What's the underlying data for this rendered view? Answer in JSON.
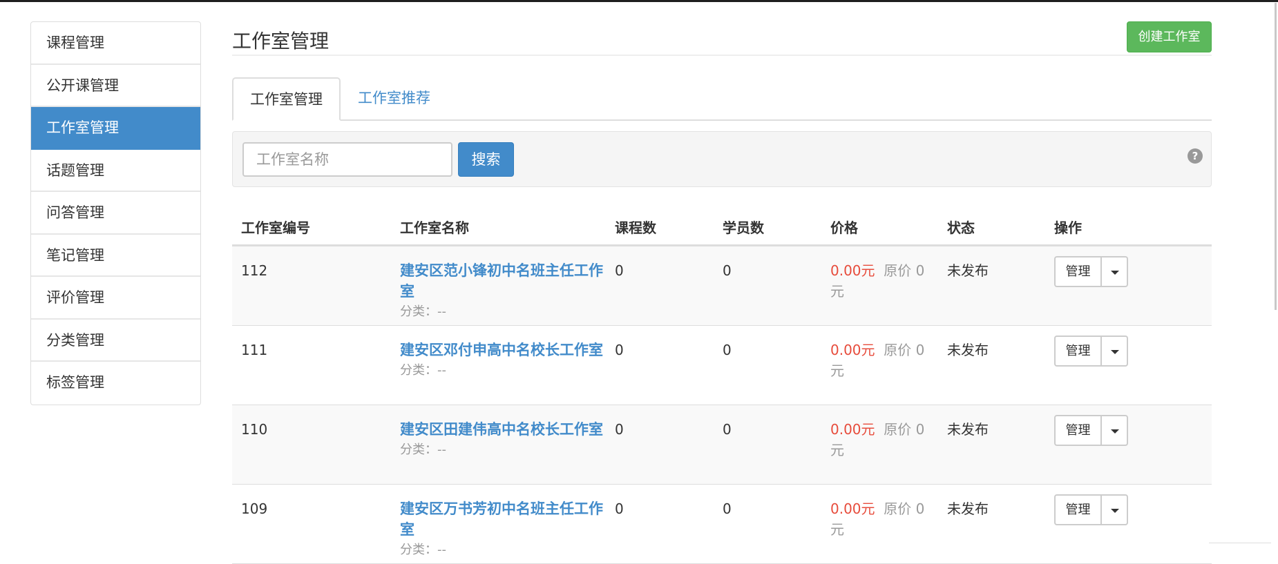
{
  "sidebar": {
    "items": [
      {
        "label": "课程管理"
      },
      {
        "label": "公开课管理"
      },
      {
        "label": "工作室管理",
        "active": true
      },
      {
        "label": "话题管理"
      },
      {
        "label": "问答管理"
      },
      {
        "label": "笔记管理"
      },
      {
        "label": "评价管理"
      },
      {
        "label": "分类管理"
      },
      {
        "label": "标签管理"
      }
    ]
  },
  "header": {
    "title": "工作室管理",
    "create_button": "创建工作室"
  },
  "tabs": [
    {
      "label": "工作室管理",
      "active": true
    },
    {
      "label": "工作室推荐"
    }
  ],
  "search": {
    "placeholder": "工作室名称",
    "button": "搜索",
    "help_icon": "question-circle-icon"
  },
  "table": {
    "columns": [
      "工作室编号",
      "工作室名称",
      "课程数",
      "学员数",
      "价格",
      "状态",
      "操作"
    ],
    "rows": [
      {
        "id": "112",
        "name": "建安区范小锋初中名班主任工作室",
        "category": "分类：--",
        "courses": "0",
        "students": "0",
        "price": "0.00元",
        "original": "原价 0",
        "unit": "元",
        "status": "未发布",
        "action": "管理"
      },
      {
        "id": "111",
        "name": "建安区邓付申高中名校长工作室",
        "category": "分类：--",
        "courses": "0",
        "students": "0",
        "price": "0.00元",
        "original": "原价 0",
        "unit": "元",
        "status": "未发布",
        "action": "管理"
      },
      {
        "id": "110",
        "name": "建安区田建伟高中名校长工作室",
        "category": "分类：--",
        "courses": "0",
        "students": "0",
        "price": "0.00元",
        "original": "原价 0",
        "unit": "元",
        "status": "未发布",
        "action": "管理"
      },
      {
        "id": "109",
        "name": "建安区万书芳初中名班主任工作室",
        "category": "分类：--",
        "courses": "0",
        "students": "0",
        "price": "0.00元",
        "original": "原价 0",
        "unit": "元",
        "status": "未发布",
        "action": "管理"
      }
    ]
  },
  "colors": {
    "primary": "#428bca",
    "success": "#5cb85c",
    "price": "#e74c3c"
  }
}
